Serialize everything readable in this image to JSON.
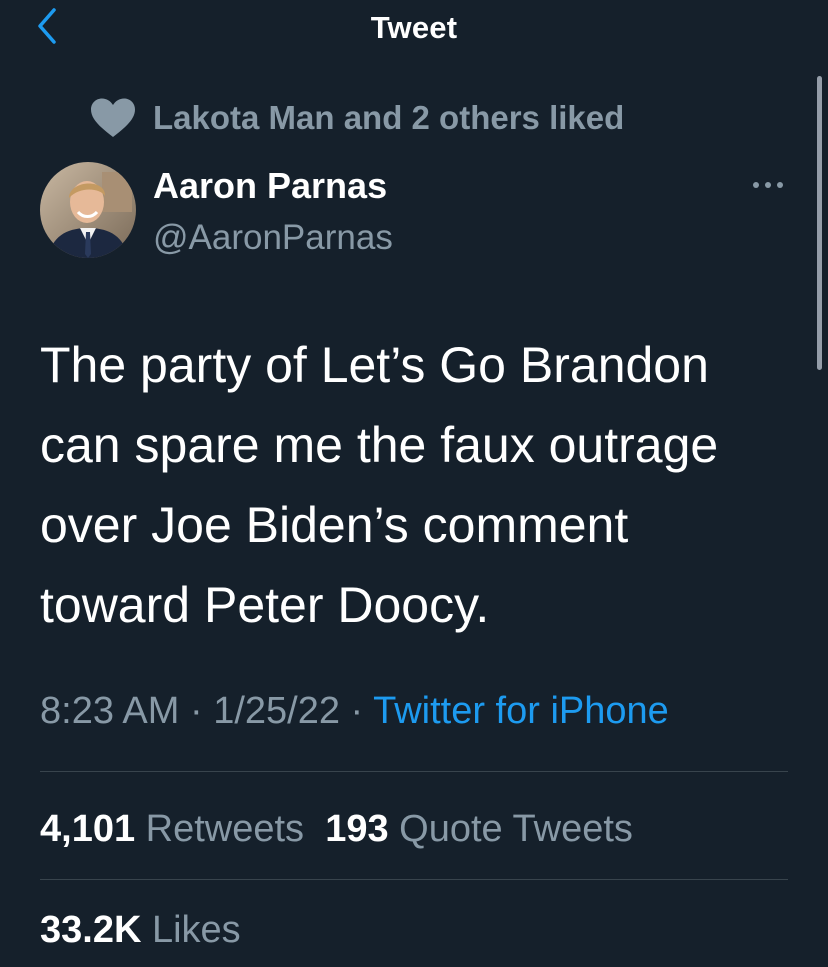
{
  "header": {
    "title": "Tweet",
    "back_icon": "chevron-left-icon"
  },
  "social_context": {
    "icon": "heart-icon",
    "text": "Lakota Man and 2 others liked"
  },
  "author": {
    "display_name": "Aaron Parnas",
    "handle": "@AaronParnas"
  },
  "more_icon": "more-horizontal-icon",
  "tweet": {
    "lines": [
      "The party of Let’s Go Brandon",
      "can spare me the faux outrage",
      "over Joe Biden’s comment",
      "toward Peter Doocy."
    ]
  },
  "meta": {
    "time": "8:23 AM",
    "separator": " · ",
    "date": "1/25/22",
    "source": "Twitter for iPhone"
  },
  "stats": {
    "retweets_count": "4,101",
    "retweets_label": "Retweets",
    "quotes_count": "193",
    "quotes_label": "Quote Tweets",
    "likes_count": "33.2K",
    "likes_label": "Likes"
  },
  "colors": {
    "background": "#15202b",
    "secondary_text": "#8899a6",
    "accent": "#1d9bf0",
    "divider": "#38444d"
  }
}
